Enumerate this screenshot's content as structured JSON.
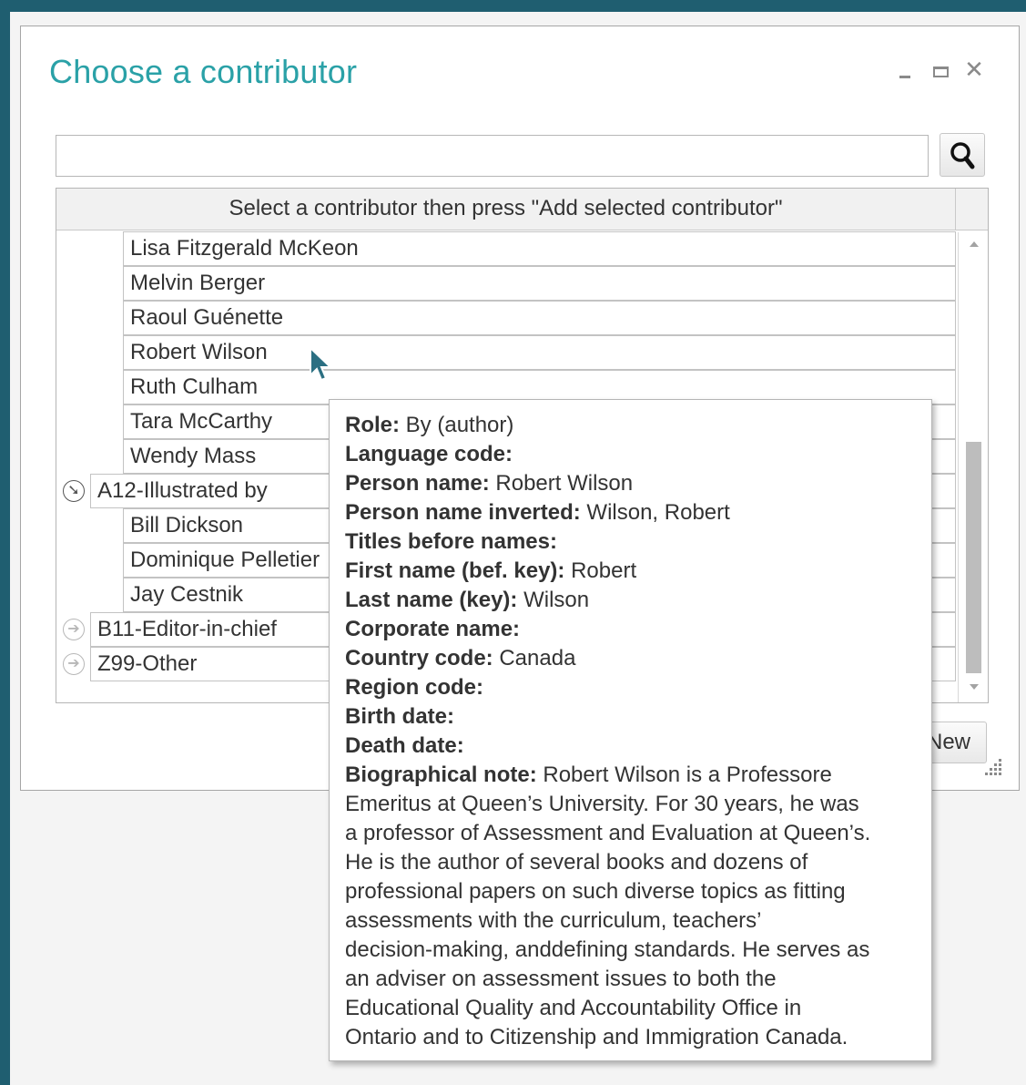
{
  "dialog": {
    "title": "Choose a contributor",
    "search_value": "",
    "grid_header": "Select a contributor then press \"Add selected contributor\"",
    "new_button_label": "New",
    "accent_color": "#2aa1a7",
    "frame_color": "#1f5e70"
  },
  "grid": {
    "rows": [
      {
        "type": "child",
        "label": "Lisa Fitzgerald McKeon"
      },
      {
        "type": "child",
        "label": "Melvin Berger"
      },
      {
        "type": "child",
        "label": "Raoul Guénette"
      },
      {
        "type": "child",
        "label": "Robert Wilson"
      },
      {
        "type": "child",
        "label": "Ruth Culham"
      },
      {
        "type": "child",
        "label": "Tara McCarthy"
      },
      {
        "type": "child",
        "label": "Wendy Mass"
      },
      {
        "type": "group",
        "label": "A12-Illustrated by",
        "expanded": true
      },
      {
        "type": "child",
        "label": "Bill Dickson"
      },
      {
        "type": "child",
        "label": "Dominique Pelletier"
      },
      {
        "type": "child",
        "label": "Jay Cestnik"
      },
      {
        "type": "group",
        "label": "B11-Editor-in-chief",
        "expanded": false
      },
      {
        "type": "group",
        "label": "Z99-Other",
        "expanded": false
      }
    ]
  },
  "tooltip": {
    "fields": [
      {
        "label": "Role:",
        "value": "By (author)"
      },
      {
        "label": "Language code:",
        "value": ""
      },
      {
        "label": "Person name:",
        "value": "Robert Wilson"
      },
      {
        "label": "Person name inverted:",
        "value": "Wilson, Robert"
      },
      {
        "label": "Titles before names:",
        "value": ""
      },
      {
        "label": "First name (bef. key):",
        "value": "Robert"
      },
      {
        "label": "Last name (key):",
        "value": "Wilson"
      },
      {
        "label": "Corporate name:",
        "value": ""
      },
      {
        "label": "Country code:",
        "value": "Canada"
      },
      {
        "label": "Region code:",
        "value": ""
      },
      {
        "label": "Birth date:",
        "value": ""
      },
      {
        "label": "Death date:",
        "value": ""
      }
    ],
    "note_label": "Biographical note:",
    "note_lines": [
      "Robert Wilson is a Professore",
      "Emeritus at Queen’s University. For 30 years, he was",
      "a professor of Assessment and Evaluation at Queen’s.",
      "He is the author of several books and dozens of",
      "professional papers on such diverse topics as fitting",
      "assessments with the curriculum, teachers’",
      "decision-making, anddefining standards. He serves as",
      "an adviser on assessment issues to both the",
      "Educational Quality and Accountability Office in",
      "Ontario and to Citizenship and Immigration Canada."
    ]
  },
  "icons": {
    "minimize": "minimize-icon",
    "maximize": "maximize-icon",
    "close": "close-icon",
    "search": "search-icon",
    "expanded": "expanded-arrow-icon",
    "collapsed": "collapsed-arrow-icon",
    "cursor": "mouse-pointer-icon",
    "resize": "resize-grip-icon"
  }
}
